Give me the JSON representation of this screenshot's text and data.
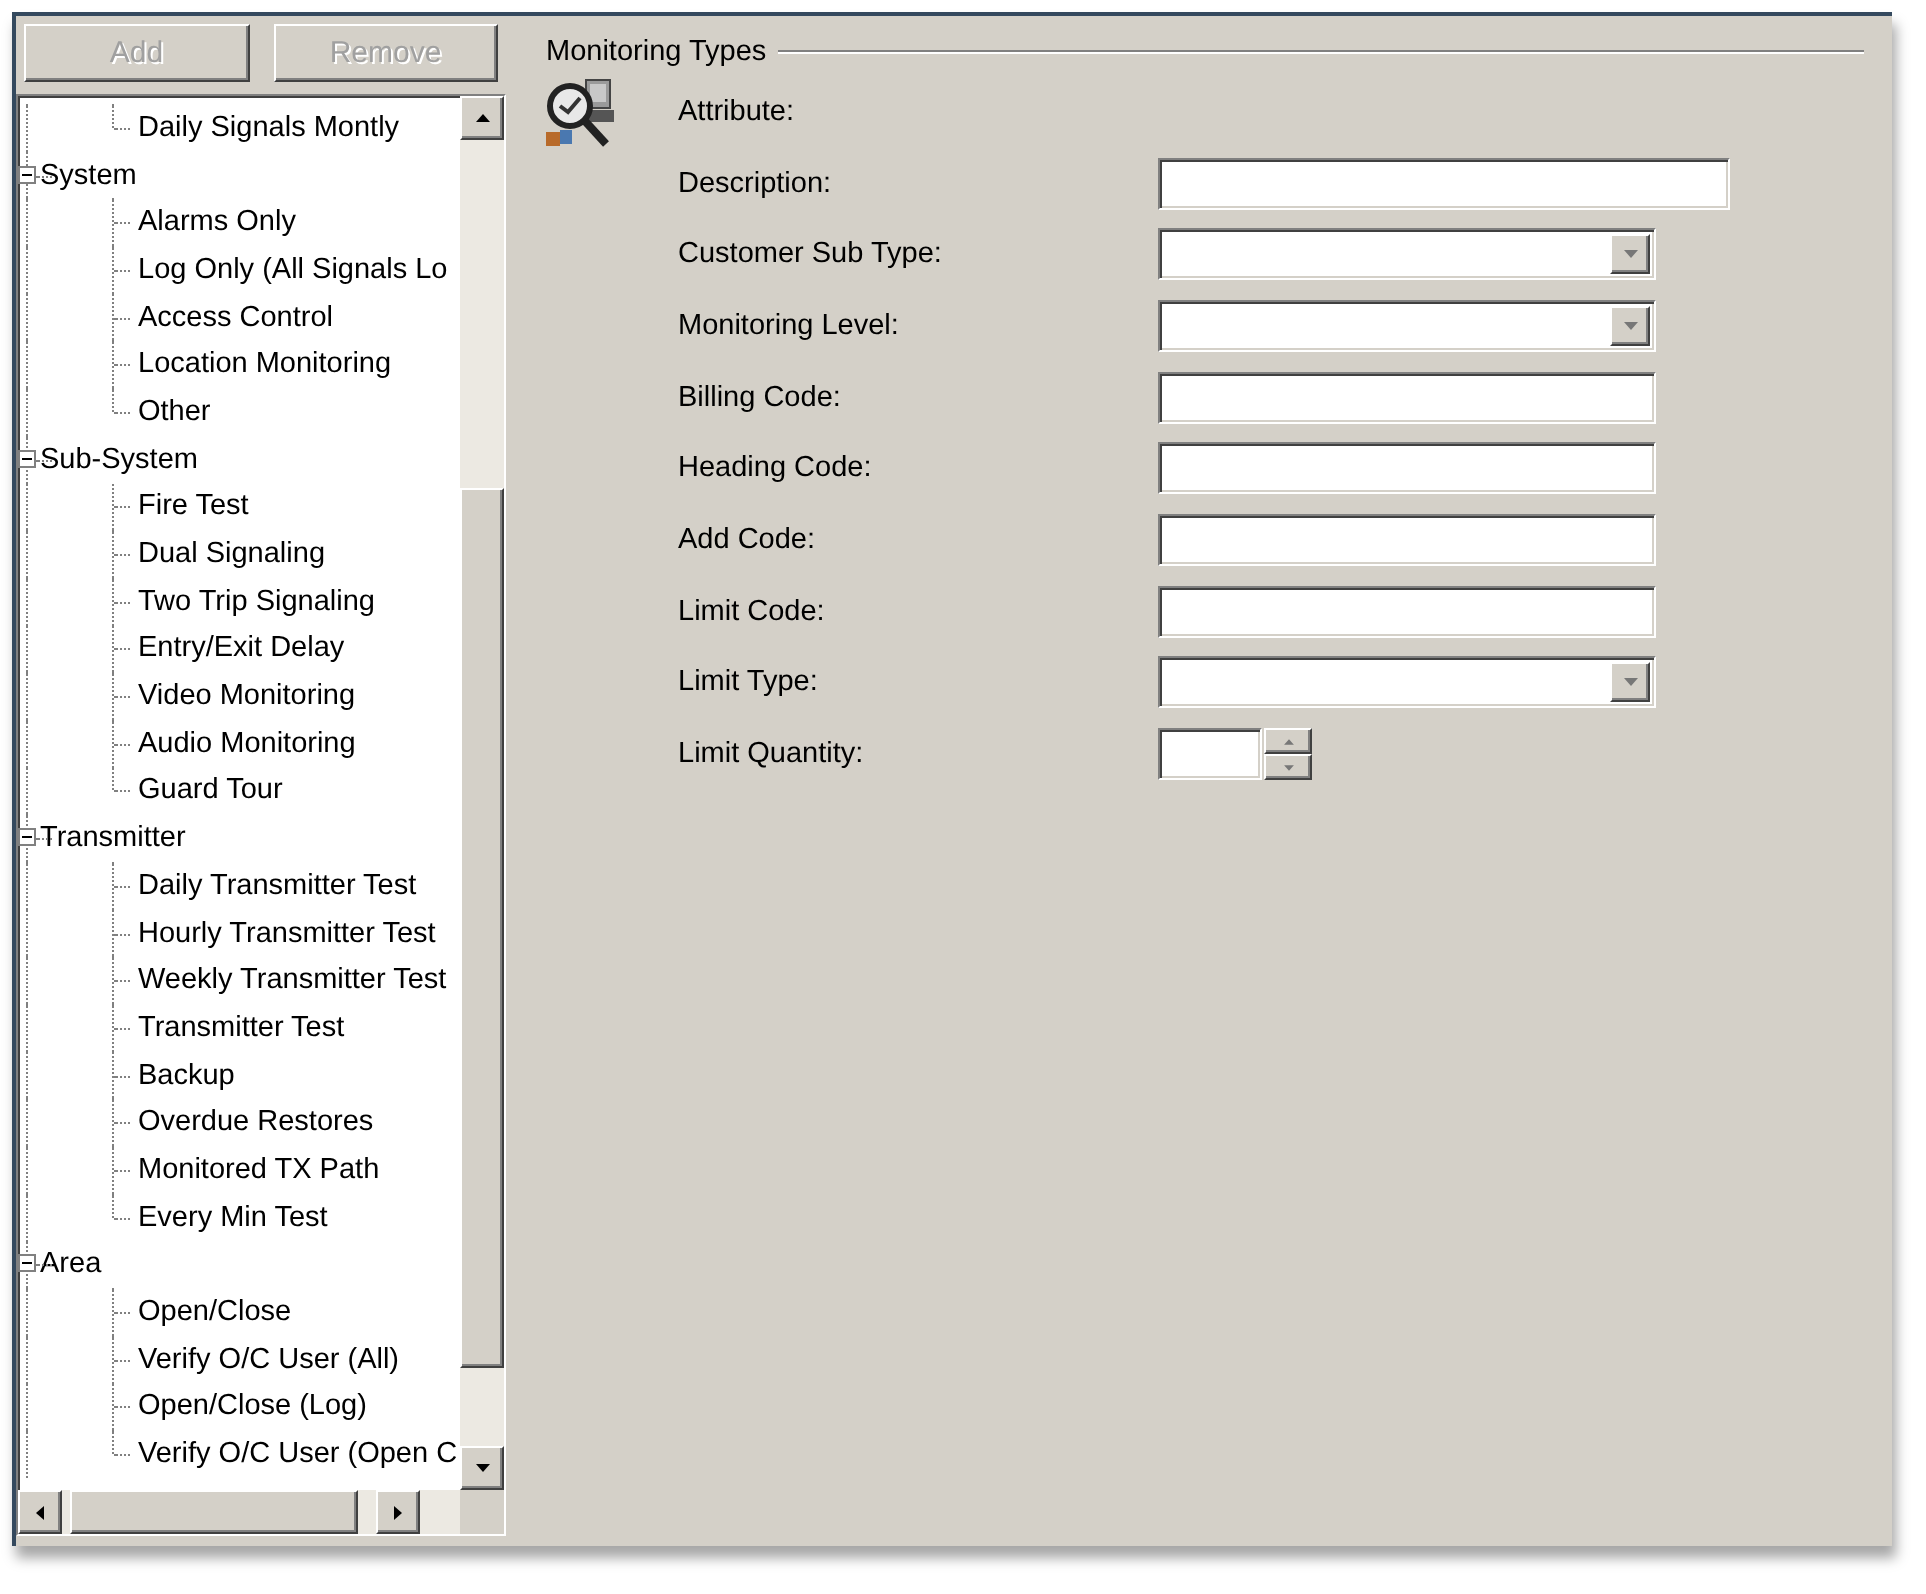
{
  "buttons": [
    {
      "label": "Add",
      "disabled": true
    },
    {
      "label": "Remove",
      "disabled": true
    }
  ],
  "tree": [
    {
      "children": [
        {
          "label": "Daily Signals Montly"
        }
      ]
    },
    {
      "label": "System",
      "expanded": true,
      "children": [
        {
          "label": "Alarms Only"
        },
        {
          "label": "Log Only (All Signals Lo"
        },
        {
          "label": "Access Control"
        },
        {
          "label": "Location Monitoring"
        },
        {
          "label": "Other"
        }
      ]
    },
    {
      "label": "Sub-System",
      "expanded": true,
      "children": [
        {
          "label": "Fire Test"
        },
        {
          "label": "Dual Signaling"
        },
        {
          "label": "Two Trip Signaling"
        },
        {
          "label": "Entry/Exit Delay"
        },
        {
          "label": "Video Monitoring"
        },
        {
          "label": "Audio Monitoring"
        },
        {
          "label": "Guard Tour"
        }
      ]
    },
    {
      "label": "Transmitter",
      "expanded": true,
      "children": [
        {
          "label": "Daily Transmitter Test"
        },
        {
          "label": "Hourly Transmitter Test"
        },
        {
          "label": "Weekly Transmitter Test"
        },
        {
          "label": "Transmitter Test"
        },
        {
          "label": "Backup"
        },
        {
          "label": "Overdue Restores"
        },
        {
          "label": "Monitored TX Path"
        },
        {
          "label": "Every Min Test"
        }
      ]
    },
    {
      "label": "Area",
      "expanded": true,
      "children": [
        {
          "label": "Open/Close"
        },
        {
          "label": "Verify O/C User (All)"
        },
        {
          "label": "Open/Close (Log)"
        },
        {
          "label": "Verify O/C User (Open C"
        }
      ]
    }
  ],
  "group": {
    "title": "Monitoring Types"
  },
  "fields": [
    {
      "label": "Attribute:",
      "kind": "label"
    },
    {
      "label": "Description:",
      "kind": "longtext"
    },
    {
      "label": "Customer Sub Type:",
      "kind": "combo"
    },
    {
      "label": "Monitoring Level:",
      "kind": "combo"
    },
    {
      "label": "Billing Code:",
      "kind": "text"
    },
    {
      "label": "Heading Code:",
      "kind": "text"
    },
    {
      "label": "Add Code:",
      "kind": "text"
    },
    {
      "label": "Limit Code:",
      "kind": "text"
    },
    {
      "label": "Limit Type:",
      "kind": "combo"
    },
    {
      "label": "Limit Quantity:",
      "kind": "spinner"
    }
  ]
}
